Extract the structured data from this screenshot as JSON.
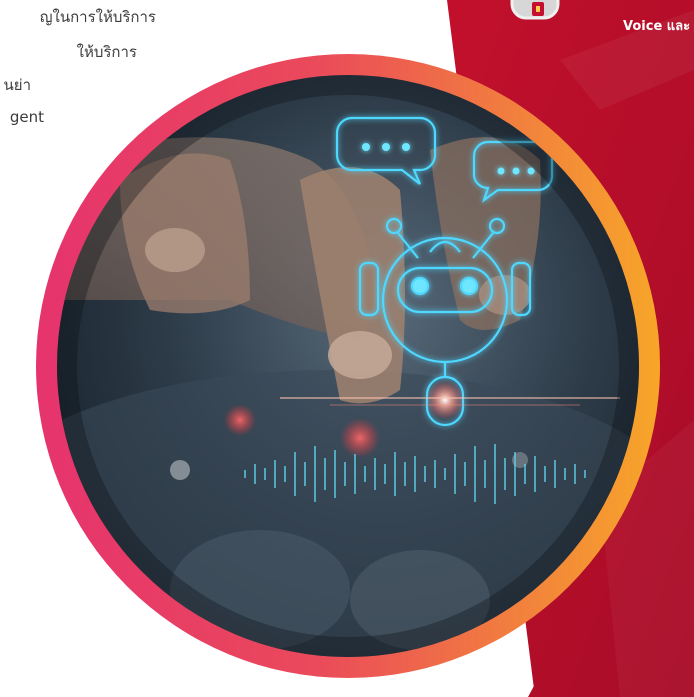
{
  "intro_lines": [
    "ญในการให้บริการ",
    "ให้บริการ",
    "นย่า",
    "gent"
  ],
  "header_text": "Voice และ",
  "illustration": {
    "subject": "robot-chatbot-hologram-over-fingertip-on-phone",
    "icons": [
      "speech-bubble-icon",
      "speech-bubble-icon",
      "robot-icon",
      "sound-wave-icon"
    ]
  },
  "colors": {
    "brand_red": "#b8102a",
    "ring_start": "#e8336b",
    "ring_end": "#f6a623",
    "hologram": "#4fd8ff"
  }
}
